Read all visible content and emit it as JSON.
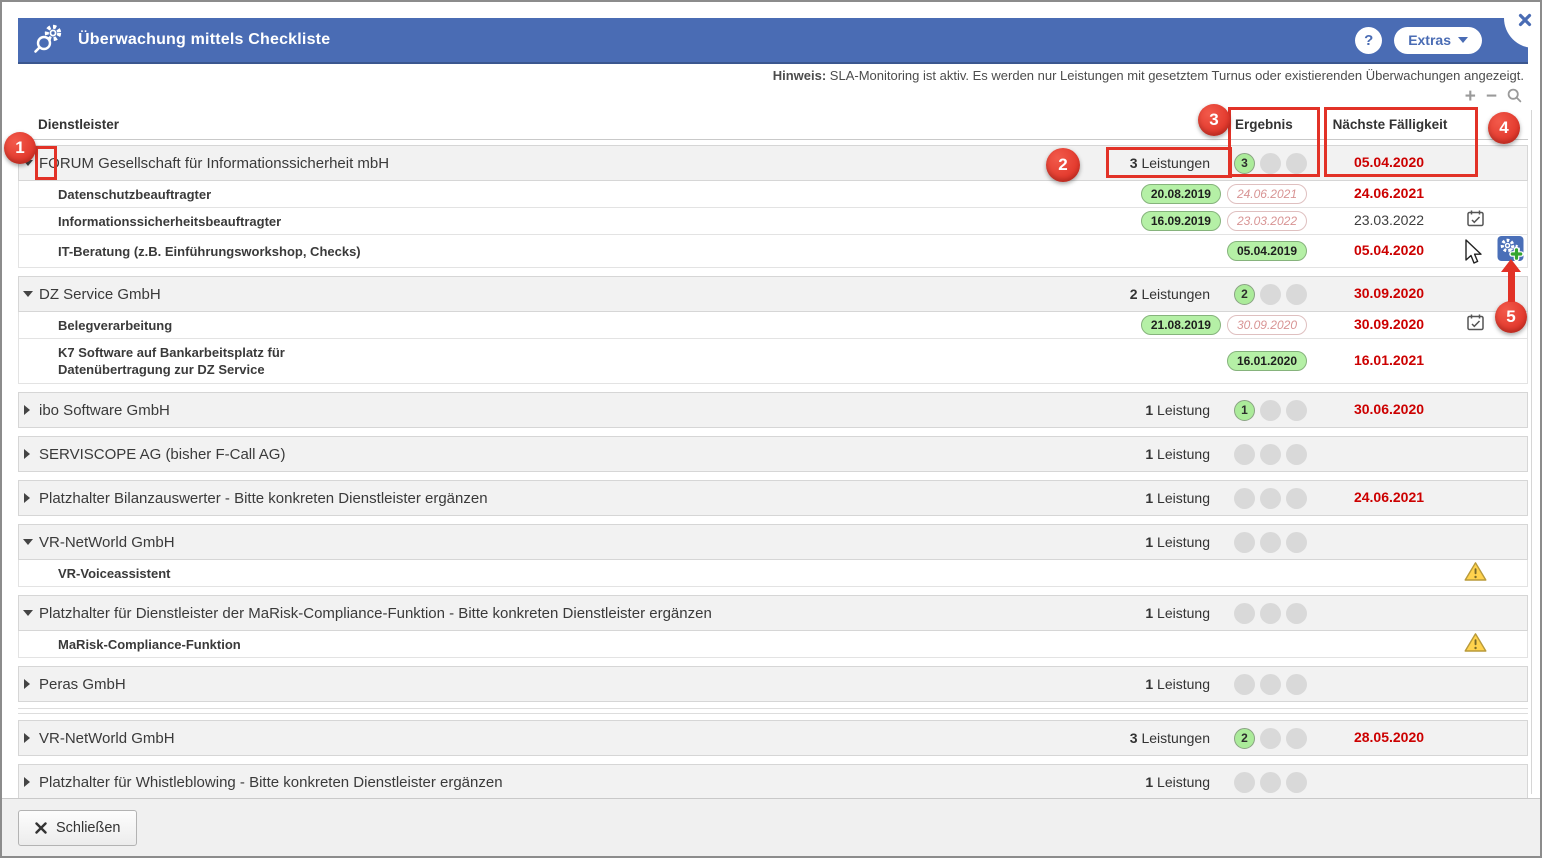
{
  "window": {
    "title": "Überwachung mittels Checkliste",
    "help": "?",
    "extras": "Extras"
  },
  "hint": {
    "label": "Hinweis:",
    "text": " SLA-Monitoring ist aktiv. Es werden nur Leistungen mit gesetztem Turnus oder existierenden Überwachungen angezeigt."
  },
  "toolbar": {
    "zoom_in": "+",
    "zoom_out": "−"
  },
  "columns": {
    "provider": "Dienstleister",
    "result": "Ergebnis",
    "next_due": "Nächste Fälligkeit"
  },
  "rows": [
    {
      "type": "group",
      "name": "FORUM Gesellschaft für Informationssicherheit mbH",
      "expanded": true,
      "count": "3",
      "count_label": "Leistungen",
      "result": "3",
      "due": "05.04.2020",
      "due_style": "red"
    },
    {
      "type": "service",
      "name": "Datenschutzbeauftragter",
      "done": "20.08.2019",
      "planned": "24.06.2021",
      "due": "24.06.2021",
      "due_style": "red"
    },
    {
      "type": "service",
      "name": "Informationssicherheitsbeauftragter",
      "done": "16.09.2019",
      "planned": "23.03.2022",
      "due": "23.03.2022",
      "due_style": "black",
      "icon": "calendar"
    },
    {
      "type": "service",
      "name": "IT-Beratung (z.B. Einführungsworkshop, Checks)",
      "done": "05.04.2019",
      "due": "05.04.2020",
      "due_style": "red",
      "icon": "add"
    },
    {
      "type": "group",
      "name": "DZ Service GmbH",
      "expanded": true,
      "count": "2",
      "count_label": "Leistungen",
      "result": "2",
      "due": "30.09.2020",
      "due_style": "red"
    },
    {
      "type": "service",
      "name": "Belegverarbeitung",
      "done": "21.08.2019",
      "planned": "30.09.2020",
      "due": "30.09.2020",
      "due_style": "red",
      "icon": "calendar"
    },
    {
      "type": "service",
      "name": "K7 Software auf Bankarbeitsplatz für",
      "name2": "Datenübertragung zur DZ Service",
      "done": "16.01.2020",
      "due": "16.01.2021",
      "due_style": "red"
    },
    {
      "type": "group",
      "name": "ibo Software GmbH",
      "expanded": false,
      "count": "1",
      "count_label": "Leistung",
      "result": "1",
      "due": "30.06.2020",
      "due_style": "red"
    },
    {
      "type": "group",
      "name": "SERVISCOPE AG (bisher F-Call AG)",
      "expanded": false,
      "count": "1",
      "count_label": "Leistung"
    },
    {
      "type": "group",
      "name": "Platzhalter Bilanzauswerter - Bitte konkreten Dienstleister ergänzen",
      "expanded": false,
      "count": "1",
      "count_label": "Leistung",
      "due": "24.06.2021",
      "due_style": "red"
    },
    {
      "type": "group",
      "name": "VR-NetWorld GmbH",
      "expanded": true,
      "count": "1",
      "count_label": "Leistung"
    },
    {
      "type": "service",
      "name": "VR-Voiceassistent",
      "icon": "warning"
    },
    {
      "type": "group",
      "name": "Platzhalter für Dienstleister der MaRisk-Compliance-Funktion - Bitte konkreten Dienstleister ergänzen",
      "expanded": true,
      "count": "1",
      "count_label": "Leistung"
    },
    {
      "type": "service",
      "name": "MaRisk-Compliance-Funktion",
      "icon": "warning"
    },
    {
      "type": "group",
      "name": "Peras GmbH",
      "expanded": false,
      "count": "1",
      "count_label": "Leistung"
    },
    {
      "type": "spacer"
    },
    {
      "type": "group",
      "name": "VR-NetWorld GmbH",
      "expanded": false,
      "count": "3",
      "count_label": "Leistungen",
      "result": "2",
      "due": "28.05.2020",
      "due_style": "red",
      "after_spacer": true
    },
    {
      "type": "group",
      "name": "Platzhalter für Whistleblowing - Bitte konkreten Dienstleister ergänzen",
      "expanded": false,
      "count": "1",
      "count_label": "Leistung"
    }
  ],
  "footer": {
    "close": "Schließen"
  },
  "annotations": {
    "callouts": [
      "1",
      "2",
      "3",
      "4",
      "5"
    ]
  },
  "colors": {
    "accent_blue": "#4a6cb4",
    "annotation_red": "#e23227",
    "ok_green": "#b5f0a6",
    "due_red": "#cc0000"
  }
}
